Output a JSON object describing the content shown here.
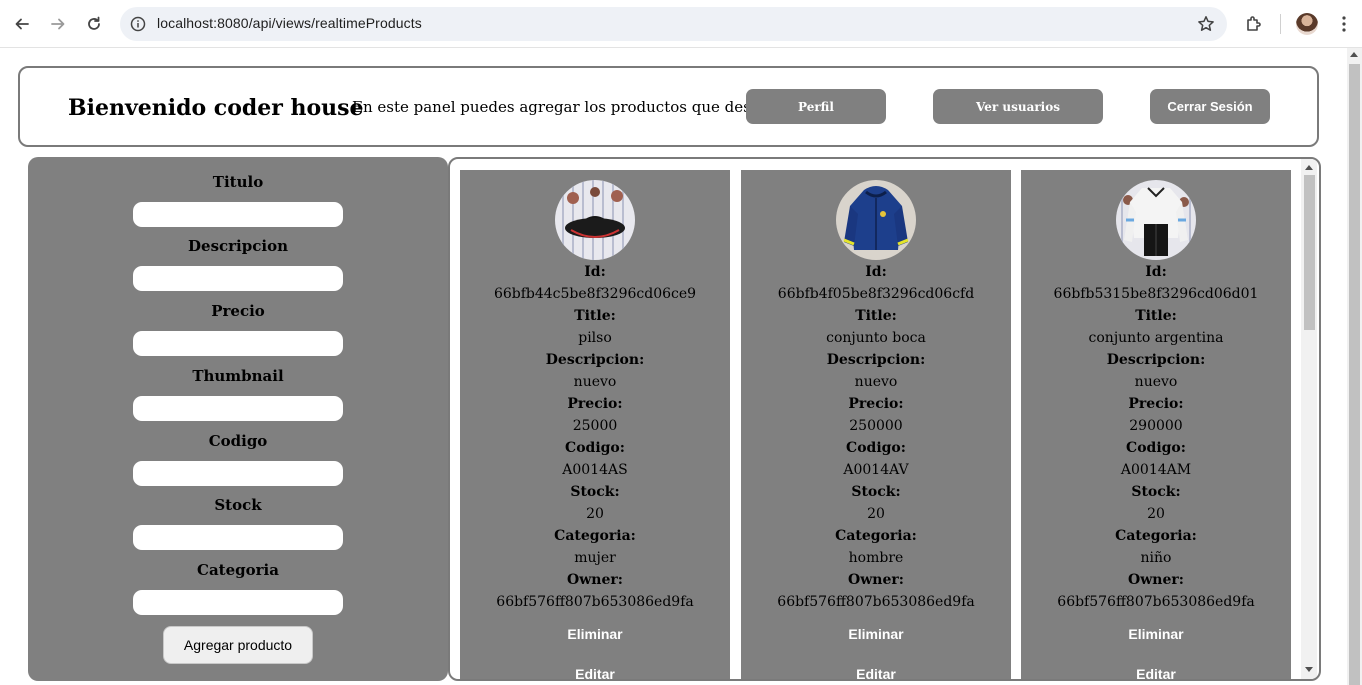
{
  "browser": {
    "url": "localhost:8080/api/views/realtimeProducts"
  },
  "header": {
    "welcome": "Bienvenido coder house",
    "description": "En este panel puedes agregar los productos que desees.",
    "buttons": {
      "perfil": "Perfil",
      "usuarios": "Ver usuarios",
      "cerrar": "Cerrar Sesión"
    }
  },
  "form": {
    "fields": [
      {
        "label": "Titulo",
        "value": ""
      },
      {
        "label": "Descripcion",
        "value": ""
      },
      {
        "label": "Precio",
        "value": ""
      },
      {
        "label": "Thumbnail",
        "value": ""
      },
      {
        "label": "Codigo",
        "value": ""
      },
      {
        "label": "Stock",
        "value": ""
      },
      {
        "label": "Categoria",
        "value": ""
      }
    ],
    "submit_label": "Agregar producto"
  },
  "labels": {
    "id": "Id:",
    "title": "Title:",
    "description": "Descripcion:",
    "price": "Precio:",
    "code": "Codigo:",
    "stock": "Stock:",
    "category": "Categoria:",
    "owner": "Owner:",
    "delete": "Eliminar",
    "edit": "Editar"
  },
  "products": [
    {
      "id": "66bfb44c5be8f3296cd06ce9",
      "title": "pilso",
      "description": "nuevo",
      "price": "25000",
      "code": "A0014AS",
      "stock": "20",
      "category": "mujer",
      "owner": "66bf576ff807b653086ed9fa",
      "thumb_icon": "bucket-hat-photo"
    },
    {
      "id": "66bfb4f05be8f3296cd06cfd",
      "title": "conjunto boca",
      "description": "nuevo",
      "price": "250000",
      "code": "A0014AV",
      "stock": "20",
      "category": "hombre",
      "owner": "66bf576ff807b653086ed9fa",
      "thumb_icon": "blue-jacket-photo"
    },
    {
      "id": "66bfb5315be8f3296cd06d01",
      "title": "conjunto argentina",
      "description": "nuevo",
      "price": "290000",
      "code": "A0014AM",
      "stock": "20",
      "category": "niño",
      "owner": "66bf576ff807b653086ed9fa",
      "thumb_icon": "tracksuit-photo"
    }
  ]
}
